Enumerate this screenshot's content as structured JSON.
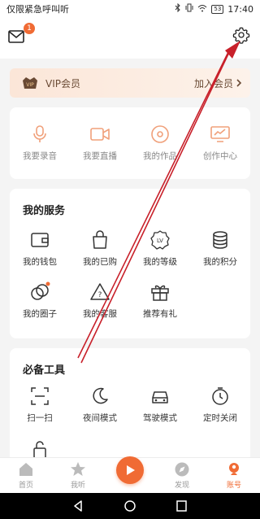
{
  "status_bar": {
    "carrier": "仅限紧急呼叫听",
    "battery": "53",
    "time": "17:40"
  },
  "header": {
    "mail_badge": "1"
  },
  "vip": {
    "label": "VIP会员",
    "join": "加入会员"
  },
  "quick": {
    "items": [
      {
        "label": "我要录音",
        "icon": "microphone-icon"
      },
      {
        "label": "我要直播",
        "icon": "video-camera-icon"
      },
      {
        "label": "我的作品",
        "icon": "disc-icon"
      },
      {
        "label": "创作中心",
        "icon": "monitor-chart-icon"
      }
    ]
  },
  "services": {
    "title": "我的服务",
    "items": [
      {
        "label": "我的钱包",
        "icon": "wallet-icon"
      },
      {
        "label": "我的已购",
        "icon": "shopping-bag-icon"
      },
      {
        "label": "我的等级",
        "icon": "level-badge-icon"
      },
      {
        "label": "我的积分",
        "icon": "coins-icon"
      },
      {
        "label": "我的圈子",
        "icon": "circles-icon"
      },
      {
        "label": "我的客服",
        "icon": "warning-icon"
      },
      {
        "label": "推荐有礼",
        "icon": "gift-icon"
      }
    ]
  },
  "tools": {
    "title": "必备工具",
    "items": [
      {
        "label": "扫一扫",
        "icon": "scan-icon"
      },
      {
        "label": "夜间模式",
        "icon": "moon-icon"
      },
      {
        "label": "驾驶模式",
        "icon": "car-icon"
      },
      {
        "label": "定时关闭",
        "icon": "timer-icon"
      }
    ]
  },
  "tab_bar": {
    "items": [
      {
        "label": "首页",
        "icon": "home-icon"
      },
      {
        "label": "我听",
        "icon": "star-icon"
      },
      {
        "label": "",
        "icon": "play-icon"
      },
      {
        "label": "发现",
        "icon": "compass-icon"
      },
      {
        "label": "账号",
        "icon": "account-icon"
      }
    ]
  },
  "colors": {
    "accent": "#f06b34",
    "annotation_arrow": "#c8202a"
  }
}
